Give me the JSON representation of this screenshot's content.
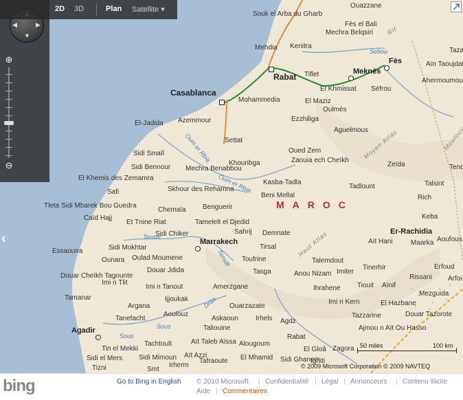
{
  "toolbar": {
    "btn_2d": "2D",
    "btn_3d": "3D",
    "plan": "Plan",
    "satellite": "Satellite"
  },
  "map": {
    "country": "MAROC",
    "cities_major": [
      {
        "name": "Casablanca"
      },
      {
        "name": "Rabat"
      },
      {
        "name": "Meknès"
      },
      {
        "name": "Fès"
      },
      {
        "name": "Marrakech"
      },
      {
        "name": "Agadir"
      }
    ],
    "places": [
      "Souk el Arba du Gharb",
      "Ouazzane",
      "Fès el Bali",
      "Mehdia",
      "Kenitra",
      "Mechra Belqsiri",
      "Sebou",
      "Taza",
      "Tiflet",
      "Aïn Taoujdate",
      "El Khmissat",
      "Séfrou",
      "Mohammedia",
      "El Maziz",
      "Ahermoumou",
      "Oulmès",
      "Ezzhiliga",
      "El-Jadida",
      "Azemmour",
      "Aguelmous",
      "Settat",
      "Oued Zem",
      "Khouribga",
      "Zaouia ech Cheïkh",
      "Sidi Smaïl",
      "Sidi Bennour",
      "Mechra Benabbou",
      "Zeïda",
      "Tendrara",
      "El Khemis des Zemamra",
      "Kasba-Tadla",
      "Beni Mellal",
      "Tadlount",
      "Talsint",
      "Safi",
      "Skhour des Rehamna",
      "Rich",
      "Tleta Sidi Mbarek Bou Guedra",
      "Benguerir",
      "Chemaïa",
      "Caïd Hajj",
      "Et Tnine Riat",
      "Tamelelt el Djedid",
      "Keba",
      "Sahrij",
      "Demnate",
      "Er-Rachidia",
      "Sidi Chiker",
      "Aït Hani",
      "Maarka",
      "Aoufous",
      "Essaouira",
      "Sidi Mokhtar",
      "Ounara",
      "Oulad Moumene",
      "Tirsal",
      "Toufrine",
      "Talemdout",
      "Erfoud",
      "Douar Jdida",
      "Tasga",
      "Anou Nizam",
      "Imiter",
      "Tinerhir",
      "Douar Cheïkh Tagounte",
      "Imi n Tlit",
      "Imi n Tanout",
      "Amerzgane",
      "Ihrahene",
      "Tiouit",
      "Aïnif",
      "Rissani",
      "Tamanar",
      "Argana",
      "Ijjoukak",
      "Ouarzazate",
      "Imi n Kern",
      "El Hazbane",
      "Mezguida",
      "Tanefacht",
      "Aoulouz",
      "Askaoun",
      "Irhels",
      "Agdz",
      "Tazzarine",
      "Aït Taleb Aïssa",
      "Taliouine",
      "Ajmou n Aït Ou Hasso",
      "Tachtoult",
      "Alougoum",
      "Rabat",
      "Tin el Mekki",
      "Aït Azzi",
      "El Gloâ",
      "Zagora",
      "Sidi Mimoun",
      "El Mhamid",
      "Sidi Ghanem",
      "Ighiti",
      "Irherm",
      "Tafraoute",
      "Tizni",
      "Smt",
      "Sidi el Mers",
      "Douar Tazorote",
      "Arfoud"
    ],
    "rivers": [
      "Oum er Rbia",
      "Oum er Rbia",
      "Tensift",
      "Tensift",
      "Sous",
      "Sous",
      "Drâa",
      "Sebou"
    ],
    "mountains": [
      "Moyen Atlas",
      "Haut Atlas",
      "Rif",
      "Moulouya"
    ],
    "scale": {
      "miles": "50 miles",
      "km": "100 km"
    },
    "copyright": "© 2009 Microsoft Corporation  © 2009 NAVTEQ"
  },
  "footer": {
    "logo": "bing",
    "go_link": "Go to Bing in English",
    "copyright": "© 2010 Microsoft",
    "links": [
      "Confidentialité",
      "Légal",
      "Annonceurs",
      "Contenu illicite",
      "Aide"
    ],
    "feedback": "Commentaires"
  }
}
